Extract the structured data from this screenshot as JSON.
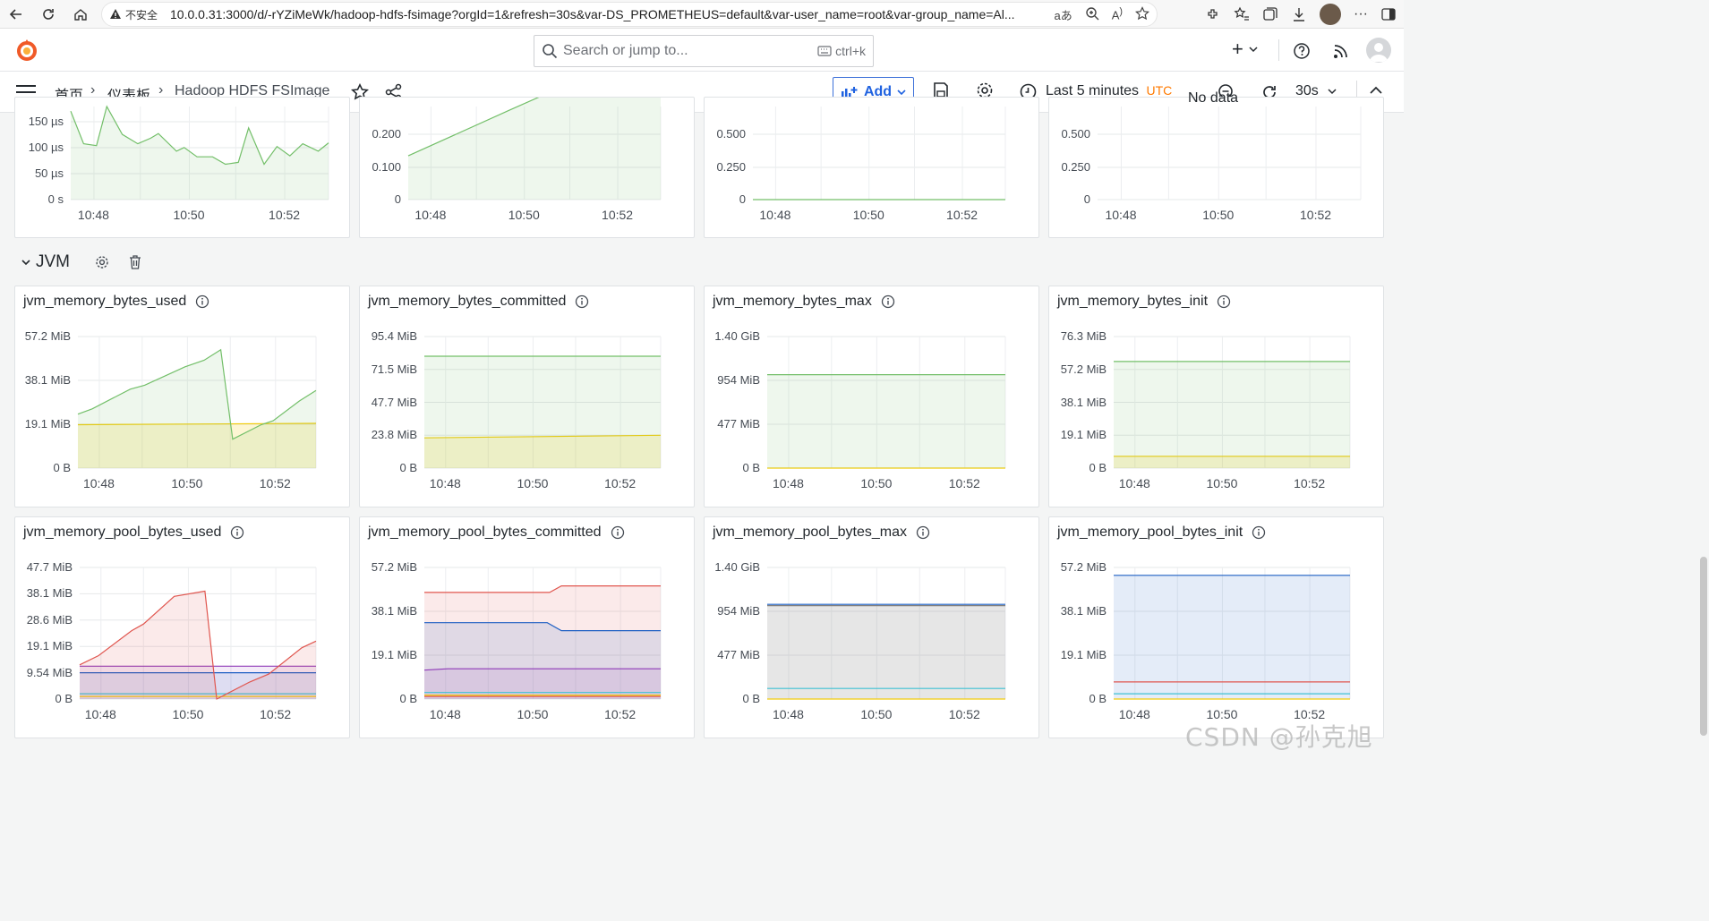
{
  "browser": {
    "insecure_label": "不安全",
    "url": "10.0.0.31:3000/d/-rYZiMeWk/hadoop-hdfs-fsimage?orgId=1&refresh=30s&var-DS_PROMETHEUS=default&var-user_name=root&var-group_name=Al..."
  },
  "topnav": {
    "search_placeholder": "Search or jump to...",
    "search_shortcut": "ctrl+k",
    "plus_label": "+"
  },
  "toolbar": {
    "breadcrumb_home": "首页",
    "breadcrumb_dashboards": "仪表板",
    "dashboard_title": "Hadoop HDFS FSImage",
    "add_label": "Add",
    "time_range": "Last 5 minutes",
    "timezone": "UTC",
    "refresh_interval": "30s"
  },
  "row": {
    "title": "JVM"
  },
  "colors": {
    "green": "#73bf69",
    "yellow": "#f2cc0c",
    "red": "#e0564f",
    "blue": "#1f60c4",
    "cyan": "#3ec1d3",
    "purple": "#8f3bb8",
    "accent": "#ff7a00"
  },
  "top_panels": [
    {
      "y_labels": [
        "150 µs",
        "100 µs",
        "50 µs",
        "0 s"
      ],
      "x_labels": [
        "10:48",
        "10:50",
        "10:52"
      ]
    },
    {
      "y_labels": [
        "0.200",
        "0.100",
        "0"
      ],
      "x_labels": [
        "10:48",
        "10:50",
        "10:52"
      ]
    },
    {
      "y_labels": [
        "0.500",
        "0.250",
        "0"
      ],
      "x_labels": [
        "10:48",
        "10:50",
        "10:52"
      ]
    },
    {
      "y_labels": [
        "0.500",
        "0.250",
        "0"
      ],
      "x_labels": [
        "10:48",
        "10:50",
        "10:52"
      ],
      "no_data": "No data"
    }
  ],
  "jvm_panels_row1": [
    {
      "title": "jvm_memory_bytes_used",
      "y_labels": [
        "57.2 MiB",
        "38.1 MiB",
        "19.1 MiB",
        "0 B"
      ],
      "x_labels": [
        "10:48",
        "10:50",
        "10:52"
      ]
    },
    {
      "title": "jvm_memory_bytes_committed",
      "y_labels": [
        "95.4 MiB",
        "71.5 MiB",
        "47.7 MiB",
        "23.8 MiB",
        "0 B"
      ],
      "x_labels": [
        "10:48",
        "10:50",
        "10:52"
      ]
    },
    {
      "title": "jvm_memory_bytes_max",
      "y_labels": [
        "1.40 GiB",
        "954 MiB",
        "477 MiB",
        "0 B"
      ],
      "x_labels": [
        "10:48",
        "10:50",
        "10:52"
      ]
    },
    {
      "title": "jvm_memory_bytes_init",
      "y_labels": [
        "76.3 MiB",
        "57.2 MiB",
        "38.1 MiB",
        "19.1 MiB",
        "0 B"
      ],
      "x_labels": [
        "10:48",
        "10:50",
        "10:52"
      ]
    }
  ],
  "jvm_panels_row2": [
    {
      "title": "jvm_memory_pool_bytes_used",
      "y_labels": [
        "47.7 MiB",
        "38.1 MiB",
        "28.6 MiB",
        "19.1 MiB",
        "9.54 MiB",
        "0 B"
      ],
      "x_labels": [
        "10:48",
        "10:50",
        "10:52"
      ]
    },
    {
      "title": "jvm_memory_pool_bytes_committed",
      "y_labels": [
        "57.2 MiB",
        "38.1 MiB",
        "19.1 MiB",
        "0 B"
      ],
      "x_labels": [
        "10:48",
        "10:50",
        "10:52"
      ]
    },
    {
      "title": "jvm_memory_pool_bytes_max",
      "y_labels": [
        "1.40 GiB",
        "954 MiB",
        "477 MiB",
        "0 B"
      ],
      "x_labels": [
        "10:48",
        "10:50",
        "10:52"
      ]
    },
    {
      "title": "jvm_memory_pool_bytes_init",
      "y_labels": [
        "57.2 MiB",
        "38.1 MiB",
        "19.1 MiB",
        "0 B"
      ],
      "x_labels": [
        "10:48",
        "10:50",
        "10:52"
      ]
    }
  ],
  "watermark": "CSDN @孙克旭"
}
